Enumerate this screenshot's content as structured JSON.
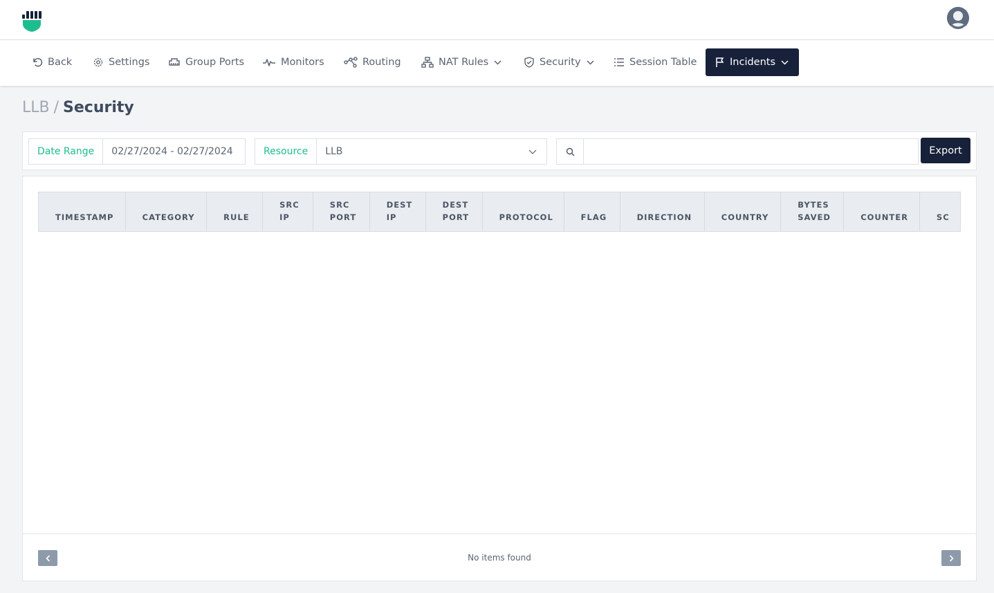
{
  "header": {
    "logo_icon": "fist-shield-logo",
    "avatar_icon": "user-avatar",
    "brand_color": "#1ebd8f"
  },
  "nav": {
    "items": [
      {
        "label": "Back",
        "icon": "undo-icon"
      },
      {
        "label": "Settings",
        "icon": "gear-icon"
      },
      {
        "label": "Group Ports",
        "icon": "ports-icon"
      },
      {
        "label": "Monitors",
        "icon": "pulse-icon"
      },
      {
        "label": "Routing",
        "icon": "routing-icon"
      },
      {
        "label": "NAT Rules",
        "icon": "network-icon",
        "dropdown": true
      },
      {
        "label": "Security",
        "icon": "shield-icon",
        "dropdown": true
      },
      {
        "label": "Session Table",
        "icon": "list-icon"
      },
      {
        "label": "Incidents",
        "icon": "flag-icon",
        "dropdown": true,
        "active": true
      }
    ],
    "active_color": "#17213a"
  },
  "breadcrumb": {
    "parent": "LLB",
    "separator": "/",
    "current": "Security"
  },
  "filters": {
    "date_range": {
      "label": "Date Range",
      "value": "02/27/2024 - 02/27/2024"
    },
    "resource": {
      "label": "Resource",
      "value": "LLB"
    },
    "search": {
      "placeholder": "",
      "value": ""
    },
    "export_label": "Export"
  },
  "table": {
    "columns": [
      {
        "line1": "",
        "line2": "TIMESTAMP"
      },
      {
        "line1": "",
        "line2": "CATEGORY"
      },
      {
        "line1": "",
        "line2": "RULE"
      },
      {
        "line1": "SRC",
        "line2": "IP"
      },
      {
        "line1": "SRC",
        "line2": "PORT"
      },
      {
        "line1": "DEST",
        "line2": "IP"
      },
      {
        "line1": "DEST",
        "line2": "PORT"
      },
      {
        "line1": "",
        "line2": "PROTOCOL"
      },
      {
        "line1": "",
        "line2": "FLAG"
      },
      {
        "line1": "",
        "line2": "DIRECTION"
      },
      {
        "line1": "",
        "line2": "COUNTRY"
      },
      {
        "line1": "BYTES",
        "line2": "SAVED"
      },
      {
        "line1": "",
        "line2": "COUNTER"
      },
      {
        "line1": "",
        "line2": "SC"
      }
    ],
    "rows": [],
    "empty_message": "No items found"
  }
}
